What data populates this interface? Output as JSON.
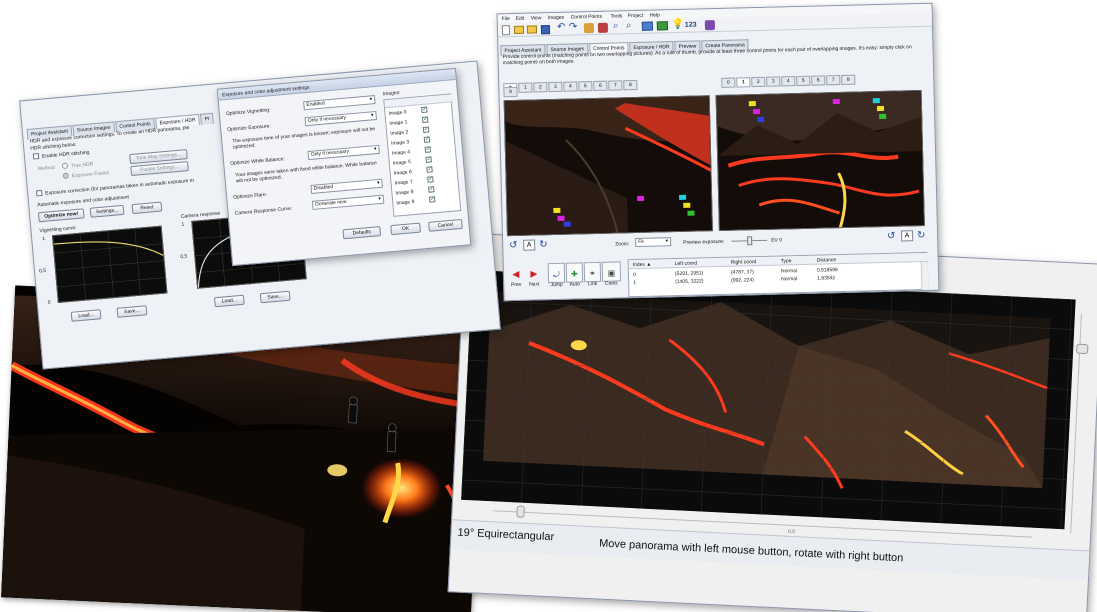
{
  "cp_window": {
    "menu": [
      "File",
      "Edit",
      "View",
      "Images",
      "Control Points",
      "Tools",
      "Project",
      "Help"
    ],
    "toolbar_counter": "123",
    "tabs": [
      "Project Assistant",
      "Source Images",
      "Control Points",
      "Exposure / HDR",
      "Preview",
      "Create Panorama"
    ],
    "active_tab": "Control Points",
    "instructions": "Provide control points (matching points on two overlapping pictures). As a rule of thumb, provide at least three control points for each pair of overlapping images. It's easy: simply click on matching points on both images.",
    "left_tabs": [
      "0",
      "1",
      "2",
      "3",
      "4",
      "5",
      "6",
      "7",
      "8",
      "9"
    ],
    "right_tabs": [
      "0",
      "1",
      "2",
      "3",
      "4",
      "5",
      "6",
      "7",
      "8"
    ],
    "zoom_label": "Zoom:",
    "zoom_value": "Fit",
    "preview_exposure_label": "Preview exposure:",
    "preview_exposure_value": "EV 0",
    "a_button": "A",
    "nav_buttons": [
      "Prev",
      "Next",
      "Jump",
      "Auto",
      "Link",
      "Contr."
    ],
    "table_headers": [
      "Index ▲",
      "Left coord",
      "Right coord",
      "Type",
      "Distance"
    ],
    "table_rows": [
      [
        "0",
        "(5291, 2951)",
        "(4787, 37)",
        "Normal",
        "0,518598"
      ],
      [
        "1",
        "(1405, 3222)",
        "(992, 224)",
        "Normal",
        "1,83542"
      ]
    ]
  },
  "hdr_window": {
    "tabs": [
      "Project Assistant",
      "Source Images",
      "Control Points",
      "Exposure / HDR",
      "Pr"
    ],
    "intro": "HDR and exposure correction settings. To create an HDR panorama, ple",
    "intro2": "HDR stitching below.",
    "enable_hdr": "Enable HDR stitching",
    "method_label": "Method",
    "true_hdr": "True HDR",
    "exposure_fusion": "Exposure Fusion",
    "tone_map_btn": "Tone Map Settings...",
    "fusion_btn": "Fusion Settings...",
    "exposure_correction": "Exposure correction (for panoramas taken in automatic exposure m",
    "auto_heading": "Automatic exposure and color adjustment",
    "optimize_now": "Optimize now!",
    "settings_btn": "Settings...",
    "reset_btn": "Reset",
    "vignetting_curve": "Vignetting curve:",
    "camera_response": "Camera response",
    "load": "Load...",
    "save": "Save...",
    "y_tick_top": "1",
    "y_tick_mid": "0,5",
    "y_tick_bottom": "0",
    "y_tick_resp_top": "1",
    "y_tick_resp_mid": "0,5"
  },
  "adjust_dialog": {
    "title": "Exposure and color adjustment settings",
    "optimize_vignetting": "Optimize Vignetting:",
    "optimize_vignetting_value": "Enabled",
    "optimize_exposure": "Optimize Exposure:",
    "optimize_exposure_value": "Only if necessary",
    "exposure_note": "The exposure time of your images is known; exposure will not be optimized.",
    "optimize_wb": "Optimize White Balance:",
    "optimize_wb_value": "Only if necessary",
    "wb_note": "Your images were taken with fixed white balance. White balance will not be optimized.",
    "optimize_flare": "Optimize Flare:",
    "optimize_flare_value": "Disabled",
    "camera_response_curve": "Camera Response Curve:",
    "camera_response_value": "Generate new",
    "images_label": "Images:",
    "images": [
      "Image 0",
      "Image 1",
      "Image 2",
      "Image 3",
      "Image 4",
      "Image 5",
      "Image 6",
      "Image 7",
      "Image 8",
      "Image 9"
    ],
    "defaults_btn": "Defaults",
    "ok_btn": "OK",
    "cancel_btn": "Cancel"
  },
  "preview_window": {
    "projection": "19° Equirectangular",
    "status": "Move panorama with left mouse button, rotate with right button",
    "slider_value": "0,0"
  },
  "colors": {
    "lava": "#ff3b1f",
    "lava_hot": "#ffd84a",
    "rock": "#2a1a12",
    "window_bg": "#eef1f6",
    "cp_magenta": "#e020e0",
    "cp_yellow": "#f0e020",
    "cp_cyan": "#20d0e0"
  }
}
